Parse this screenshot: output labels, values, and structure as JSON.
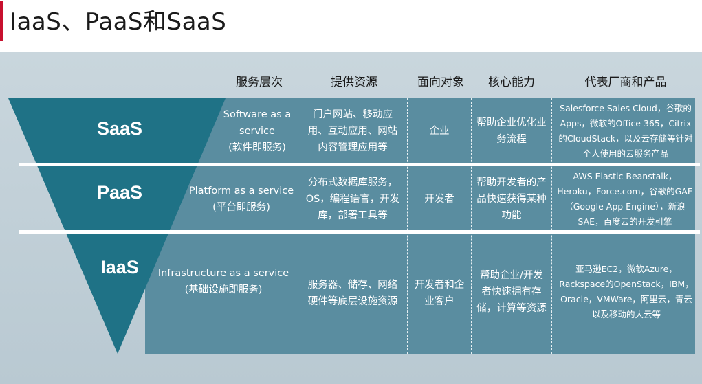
{
  "title": "IaaS、PaaS和SaaS",
  "headers": {
    "service_level": "服务层次",
    "resources": "提供资源",
    "audience": "面向对象",
    "capability": "核心能力",
    "vendors": "代表厂商和产品"
  },
  "rows": [
    {
      "layer": "SaaS",
      "service_en": "Software as a service",
      "service_cn": "(软件即服务)",
      "resources": "门户网站、移动应用、互动应用、网站内容管理应用等",
      "audience": "企业",
      "capability": "帮助企业优化业务流程",
      "vendors": "Salesforce Sales Cloud，谷歌的Apps，微软的Office 365，Citrix的CloudStack，以及云存储等针对个人使用的云服务产品"
    },
    {
      "layer": "PaaS",
      "service_en": "Platform as a service",
      "service_cn": "(平台即服务)",
      "resources": "分布式数据库服务，OS，编程语言，开发库，部署工具等",
      "audience": "开发者",
      "capability": "帮助开发者的产品快速获得某种功能",
      "vendors": "AWS Elastic Beanstalk，Heroku，Force.com，谷歌的GAE（Google App Engine），新浪SAE，百度云的开发引擎"
    },
    {
      "layer": "IaaS",
      "service_en": "Infrastructure as a service",
      "service_cn": "(基础设施即服务)",
      "resources": "服务器、储存、网络硬件等底层设施资源",
      "audience": "开发者和企业客户",
      "capability": "帮助企业/开发者快速拥有存储，计算等资源",
      "vendors": "亚马逊EC2，微软Azure，Rackspace的OpenStack，IBM，Oracle，VMWare，阿里云，青云以及移动的大云等"
    }
  ],
  "colors": {
    "accent": "#c8102e",
    "funnel": "#1f7286",
    "table": "#5a8da0",
    "panel": "#c9d6dd"
  }
}
